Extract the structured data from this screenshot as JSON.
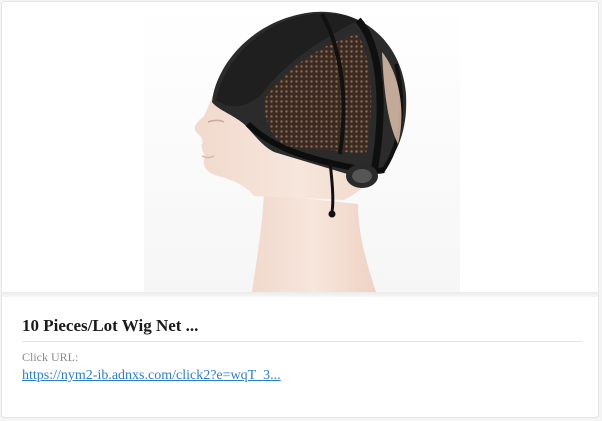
{
  "ad": {
    "image_subject": "wig-cap-on-mannequin",
    "title": "10 Pieces/Lot Wig Net ...",
    "click_label": "Click URL:",
    "click_url": "https://nym2-ib.adnxs.com/click2?e=wqT_3..."
  },
  "colors": {
    "link": "#2a7ec8",
    "title": "#1b1b1b",
    "label": "#8a8a8a"
  }
}
